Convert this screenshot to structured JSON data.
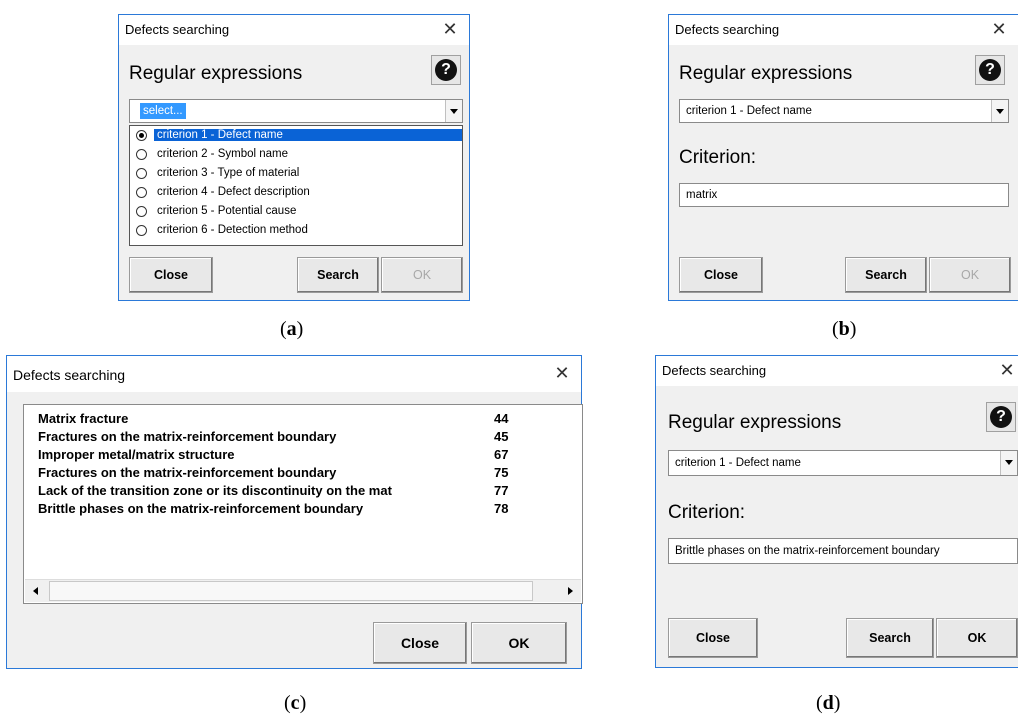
{
  "dialog_title": "Defects searching",
  "heading": "Regular expressions",
  "criterion_label": "Criterion:",
  "help_glyph": "?",
  "close_glyph": "✕",
  "panel_a": {
    "caption": "a",
    "combo_value": "select...",
    "options": [
      "criterion 1 - Defect name",
      "criterion 2 - Symbol name",
      "criterion 3 - Type of material",
      "criterion 4 - Defect description",
      "criterion 5 - Potential cause",
      "criterion 6 - Detection method"
    ],
    "selected_index": 0,
    "buttons": {
      "close": "Close",
      "search": "Search",
      "ok": "OK"
    }
  },
  "panel_b": {
    "caption": "b",
    "combo_value": "criterion 1 - Defect name",
    "criterion_value": "matrix",
    "buttons": {
      "close": "Close",
      "search": "Search",
      "ok": "OK"
    }
  },
  "panel_c": {
    "caption": "c",
    "results": [
      {
        "name": "Matrix fracture",
        "num": "44"
      },
      {
        "name": "Fractures on the matrix-reinforcement boundary",
        "num": "45"
      },
      {
        "name": "Improper metal/matrix structure",
        "num": "67"
      },
      {
        "name": "Fractures on the matrix-reinforcement boundary",
        "num": "75"
      },
      {
        "name": "Lack of the transition zone or its discontinuity on the mat",
        "num": "77"
      },
      {
        "name": "Brittle phases on the matrix-reinforcement boundary",
        "num": "78"
      }
    ],
    "buttons": {
      "close": "Close",
      "ok": "OK"
    }
  },
  "panel_d": {
    "caption": "d",
    "combo_value": "criterion 1 - Defect name",
    "criterion_value": "Brittle phases on the matrix-reinforcement boundary",
    "buttons": {
      "close": "Close",
      "search": "Search",
      "ok": "OK"
    }
  }
}
